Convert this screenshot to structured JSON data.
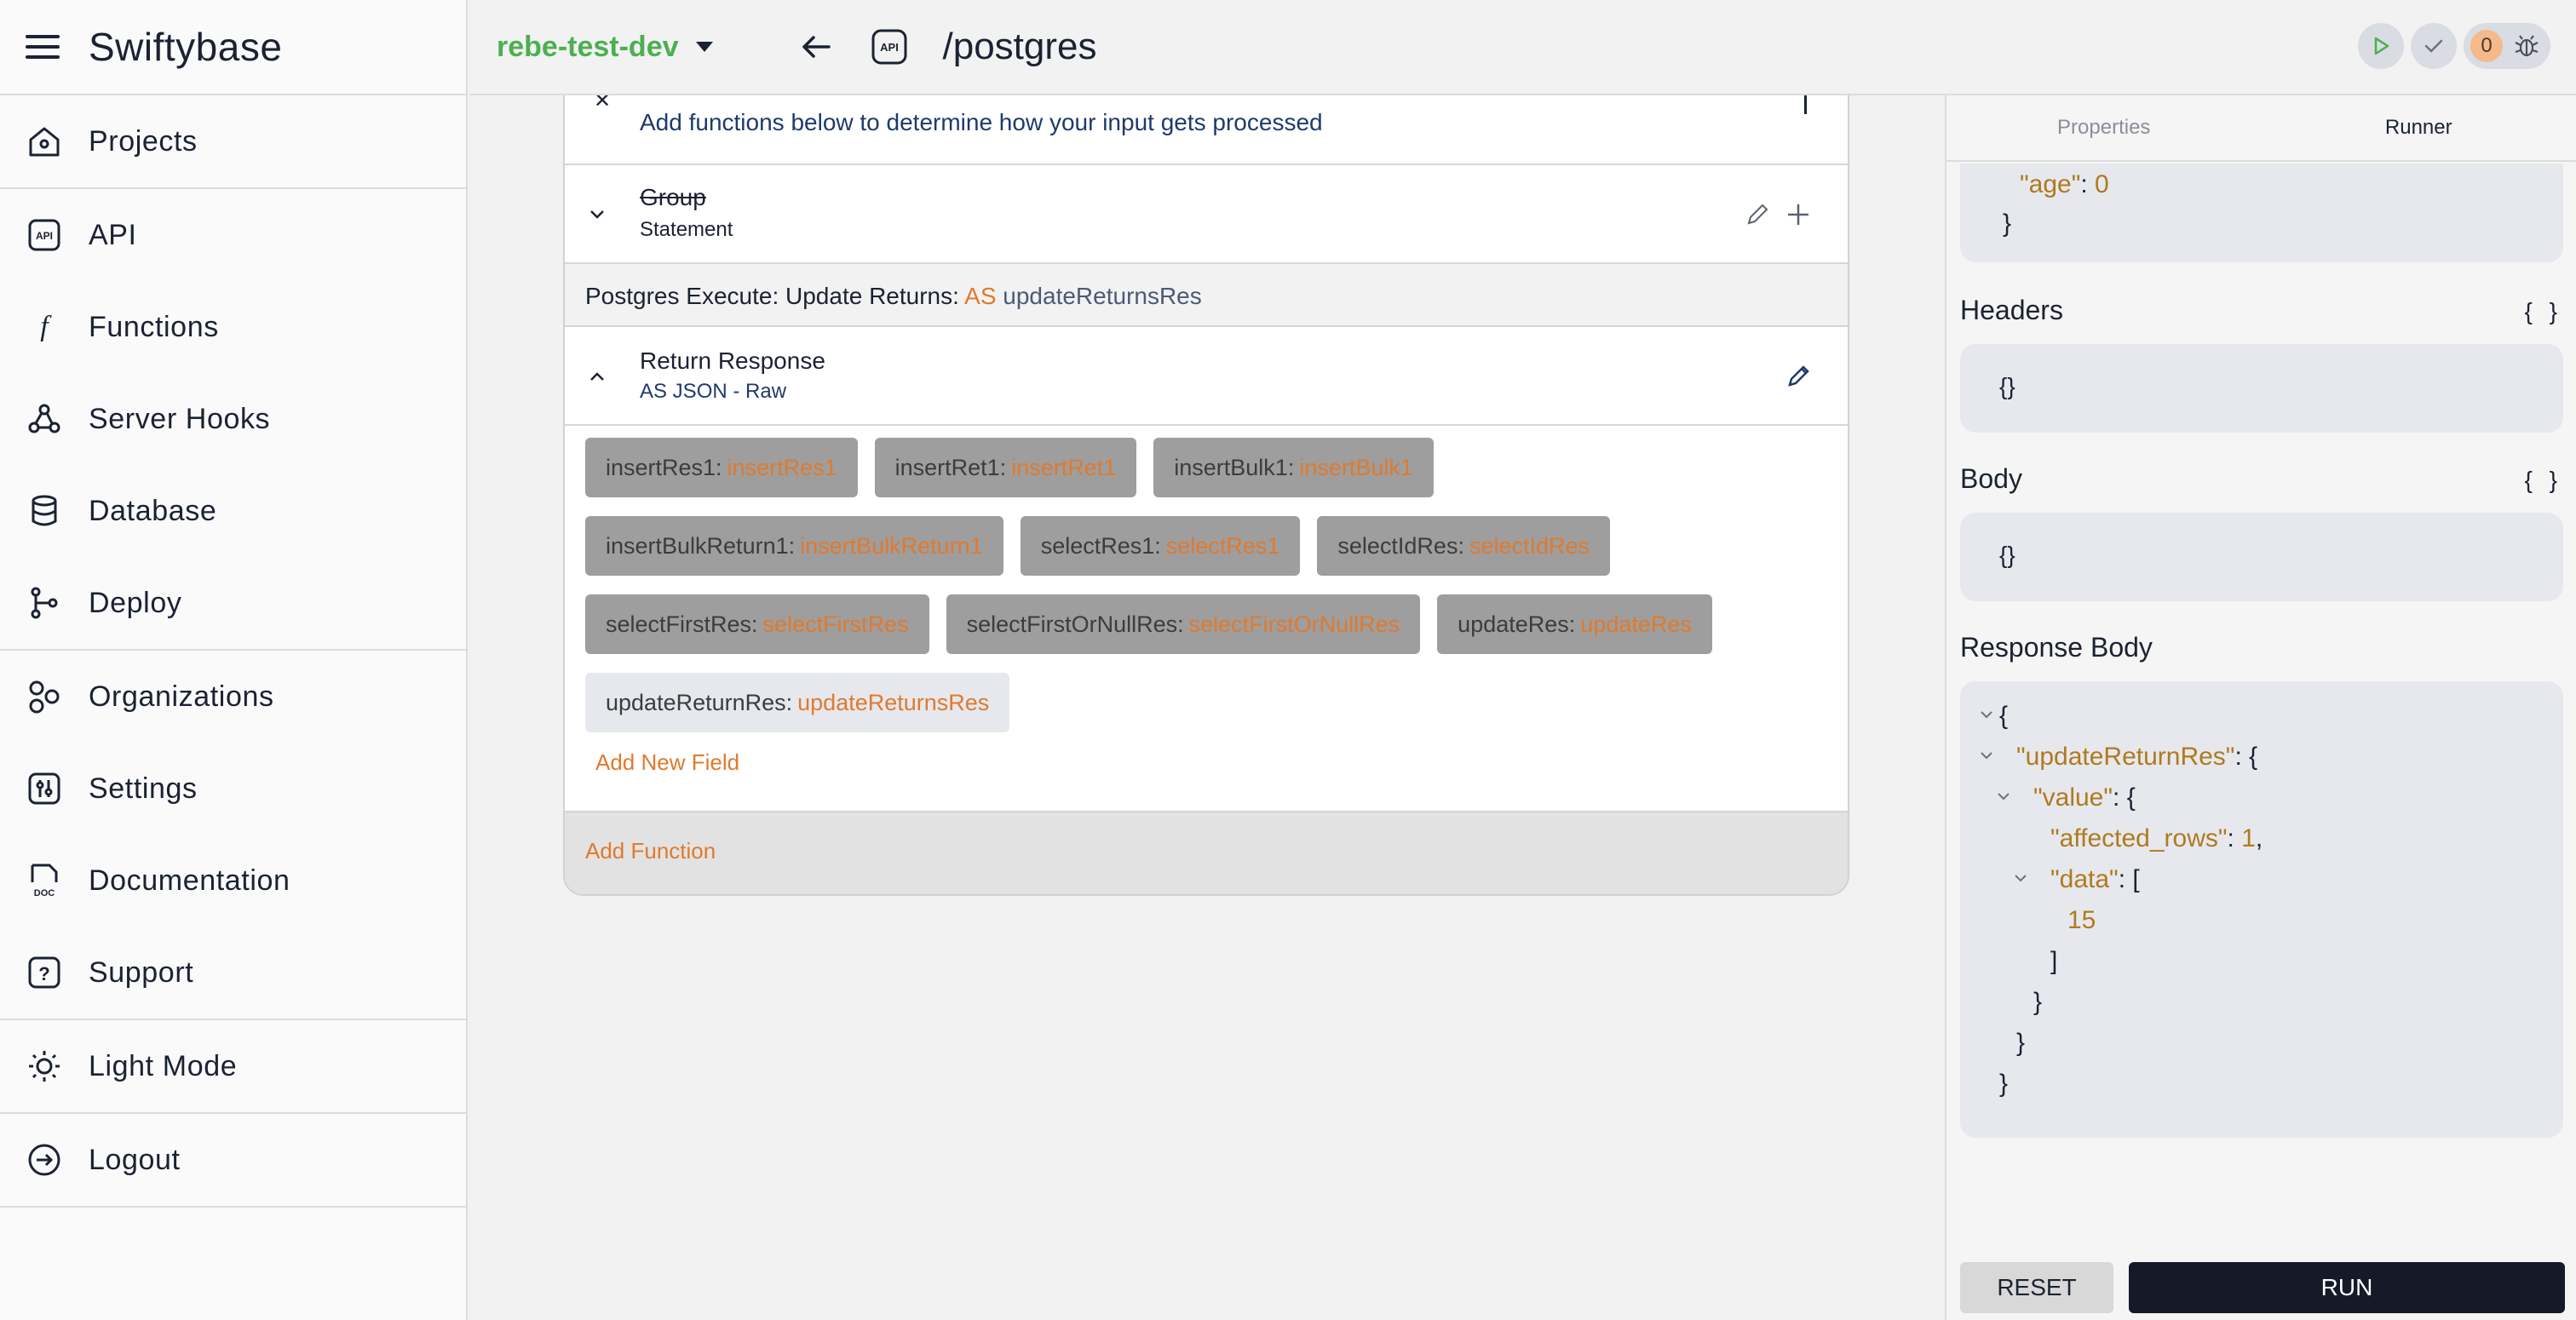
{
  "app": {
    "brand": "Swiftybase"
  },
  "sidebar": {
    "sections": [
      [
        {
          "label": "Projects",
          "icon": "home-icon"
        }
      ],
      [
        {
          "label": "API",
          "icon": "api-icon"
        },
        {
          "label": "Functions",
          "icon": "function-icon"
        },
        {
          "label": "Server Hooks",
          "icon": "webhook-icon"
        },
        {
          "label": "Database",
          "icon": "database-icon"
        },
        {
          "label": "Deploy",
          "icon": "branch-icon"
        }
      ],
      [
        {
          "label": "Organizations",
          "icon": "organizations-icon"
        },
        {
          "label": "Settings",
          "icon": "settings-icon"
        },
        {
          "label": "Documentation",
          "icon": "doc-icon"
        },
        {
          "label": "Support",
          "icon": "help-icon"
        }
      ],
      [
        {
          "label": "Light Mode",
          "icon": "sun-icon"
        }
      ],
      [
        {
          "label": "Logout",
          "icon": "logout-icon"
        }
      ]
    ]
  },
  "topbar": {
    "project": "rebe-test-dev",
    "route": "/postgres",
    "api_badge": "API",
    "issue_count": "0"
  },
  "editor": {
    "intro": "Add functions below to determine how your input gets processed",
    "group": {
      "title": "Group",
      "subtitle": "Statement"
    },
    "exec": {
      "prefix": "Postgres Execute: Update Returns:",
      "as": "AS",
      "var": "updateReturnsRes"
    },
    "return": {
      "title": "Return Response",
      "subtitle": "AS JSON - Raw"
    },
    "chips": [
      [
        {
          "key": "insertRes1:",
          "val": "insertRes1"
        },
        {
          "key": "insertRet1:",
          "val": "insertRet1"
        },
        {
          "key": "insertBulk1:",
          "val": "insertBulk1"
        }
      ],
      [
        {
          "key": "insertBulkReturn1:",
          "val": "insertBulkReturn1"
        },
        {
          "key": "selectRes1:",
          "val": "selectRes1"
        },
        {
          "key": "selectIdRes:",
          "val": "selectIdRes"
        }
      ],
      [
        {
          "key": "selectFirstRes:",
          "val": "selectFirstRes"
        },
        {
          "key": "selectFirstOrNullRes:",
          "val": "selectFirstOrNullRes"
        },
        {
          "key": "updateRes:",
          "val": "updateRes"
        }
      ],
      [
        {
          "key": "updateReturnRes:",
          "val": "updateReturnsRes",
          "active": true
        }
      ]
    ],
    "add_field": "Add New Field",
    "add_function": "Add Function"
  },
  "runner": {
    "tabs": [
      "Properties",
      "Runner"
    ],
    "active_tab": "Runner",
    "params_tail": {
      "key": "\"age\"",
      "value": "0",
      "close": "}"
    },
    "headers": {
      "title": "Headers",
      "brace": "{ }",
      "value": "{}"
    },
    "body": {
      "title": "Body",
      "brace": "{ }",
      "value": "{}"
    },
    "response": {
      "title": "Response Body",
      "lines": {
        "l1": "{",
        "l2k": "\"updateReturnRes\"",
        "l2r": ": {",
        "l3k": "\"value\"",
        "l3r": ": {",
        "l4k": "\"affected_rows\"",
        "l4r": ": ",
        "l4v": "1",
        "l4c": ",",
        "l5k": "\"data\"",
        "l5r": ": [",
        "l6": "15",
        "l7": "]",
        "l8": "}",
        "l9": "}",
        "l10": "}"
      }
    },
    "reset_label": "RESET",
    "run_label": "RUN"
  }
}
